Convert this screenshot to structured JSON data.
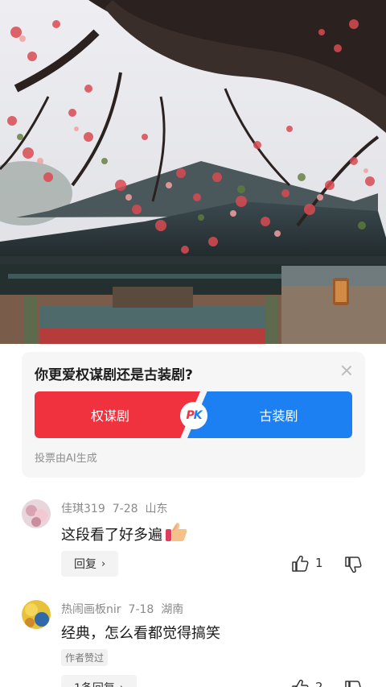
{
  "hero": {
    "image_desc_icon": "blossom-temple-photo"
  },
  "poll": {
    "question": "你更爱权谋剧还是古装剧?",
    "option_a": "权谋剧",
    "option_b": "古装剧",
    "pk_left": "P",
    "pk_right": "K",
    "note": "投票由AI生成",
    "colors": {
      "option_a": "#f0323f",
      "option_b": "#1d80f2"
    }
  },
  "comments": [
    {
      "user": "佳琪319",
      "date": "7-28",
      "location": "山东",
      "text": "这段看了好多遍",
      "emoji_icon": "thumbs-up-emoji",
      "reply_label": "回复",
      "likes": "1"
    },
    {
      "user": "热闹画板nir",
      "date": "7-18",
      "location": "湖南",
      "text": "经典，怎么看都觉得搞笑",
      "badge": "作者赞过",
      "reply_label": "1条回复",
      "likes": "2"
    }
  ]
}
